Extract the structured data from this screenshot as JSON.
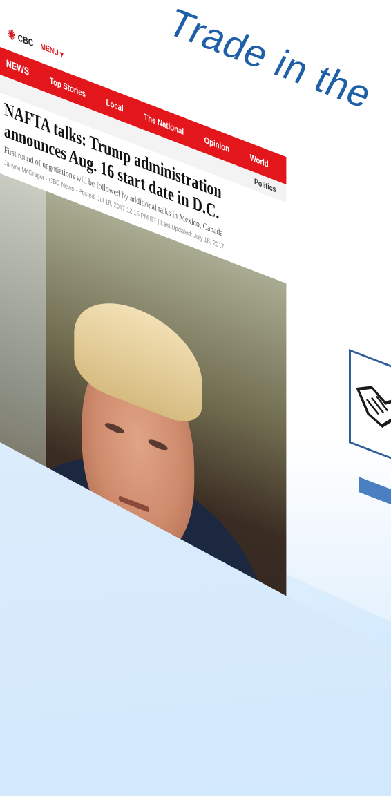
{
  "slide": {
    "title": "Trade in the"
  },
  "article": {
    "brand": "CBC",
    "menu_label": "MENU",
    "nav": [
      "NEWS",
      "Top Stories",
      "Local",
      "The National",
      "Opinion",
      "World"
    ],
    "section": "Politics",
    "headline": "NAFTA talks: Trump administration announces Aug. 16 start date in D.C.",
    "deck": "First round of negotiations will be followed by additional talks in Mexico, Canada",
    "byline": "Janyce McGregor · CBC News · Posted: Jul 18, 2017 12:15 PM ET | Last Updated: July 18, 2017"
  },
  "icons": {
    "cbc_gem": "cbc-gem-icon",
    "handshake": "handshake-icon",
    "arrow": "arrow-icon"
  },
  "colors": {
    "title": "#1f5fa8",
    "nav_red": "#e3161c",
    "accent_blue": "#4a7fc1"
  }
}
